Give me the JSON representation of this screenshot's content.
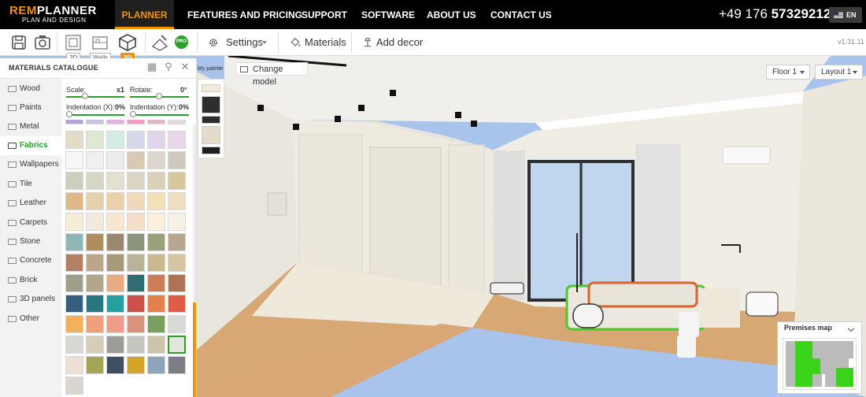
{
  "brand": {
    "name_left": "REM",
    "name_right": "PLANNER",
    "tagline": "PLAN AND DESIGN",
    "accent": "#f29400"
  },
  "nav": {
    "items": [
      "PLANNER",
      "FEATURES AND PRICING",
      "SUPPORT",
      "SOFTWARE",
      "ABOUT US",
      "CONTACT US"
    ],
    "active": "PLANNER",
    "phone_prefix": "+49 176",
    "phone_number": "57329212",
    "language": "EN"
  },
  "toolbar": {
    "icons": [
      "save-icon",
      "screenshot-icon",
      "view-2d-icon",
      "view-walls-icon",
      "view-3d-icon",
      "floor-edit-icon"
    ],
    "view_modes": [
      "2D",
      "Walls",
      "3D"
    ],
    "active_view": "3D",
    "pro_badge": "PRO",
    "settings_label": "Settings",
    "materials_label": "Materials",
    "decor_label": "Add decor",
    "version": "v1.31.11"
  },
  "catalogue": {
    "title": "MATERIALS CATALOGUE",
    "categories": [
      "Wood",
      "Paints",
      "Metal",
      "Fabrics",
      "Wallpapers",
      "Tile",
      "Leather",
      "Carpets",
      "Stone",
      "Concrete",
      "Brick",
      "3D panels",
      "Other"
    ],
    "active_category": "Fabrics",
    "params": {
      "scale_label": "Scale:",
      "scale_value": "x1",
      "rotate_label": "Rotate:",
      "rotate_value": "0°",
      "indent_x_label": "Indentation (X):",
      "indent_x_value": "0%",
      "indent_y_label": "Indentation (Y):",
      "indent_y_value": "0%"
    },
    "swatch_colors": [
      [
        "#e2dcc6",
        "#dfe9d2",
        "#d5ebe6",
        "#d5d9ea",
        "#e0d5ea",
        "#e9d6e8"
      ],
      [
        "#f7f7f7",
        "#f0f0f0",
        "#ececec",
        "#d9c8b3",
        "#dcd6cc",
        "#d1c8bd"
      ],
      [
        "#cccfbc",
        "#d7d7c8",
        "#e3e0cf",
        "#d9d6c5",
        "#dbd1bb",
        "#d6c79f"
      ],
      [
        "#deb987",
        "#e3d2ac",
        "#ebd1a9",
        "#f0d9b8",
        "#f4dfb6",
        "#efddc2"
      ],
      [
        "#f5edd6",
        "#f2eadc",
        "#f7e7d0",
        "#f5dec8",
        "#faf0dc",
        "#f6f1e4"
      ],
      [
        "#8fb6b4",
        "#b08d5e",
        "#9b8770",
        "#88957a",
        "#9b9f7a",
        "#b8a690"
      ],
      [
        "#b28064",
        "#bea58a",
        "#a79a79",
        "#b9b498",
        "#c9b98d",
        "#d4c4a0"
      ],
      [
        "#9d9f8b",
        "#b4a68a",
        "#eaaa84",
        "#2f6d73",
        "#cc7d57",
        "#b07254"
      ],
      [
        "#355f7d",
        "#28767f",
        "#24a09f",
        "#cc5148",
        "#e47f4e",
        "#df5d43"
      ],
      [
        "#f5b05d",
        "#f0a17c",
        "#ef9c8b",
        "#d9937c",
        "#79a05f",
        "#d9d9d6"
      ],
      [
        "#d7d7d3",
        "#d6ccb7",
        "#9c9d98",
        "#c4c7c0",
        "#ccc3ad",
        "#e5e5e0"
      ],
      [
        "#ece0d2",
        "#a4a556",
        "#3f4f62",
        "#d6a22a",
        "#8fa4b8",
        "#7b7f83"
      ],
      [
        "#d9d5cf"
      ]
    ],
    "selected_swatch": "row-11-col-6",
    "top_partial_row": [
      "#b7a3da",
      "#c9c1e6",
      "#e1b3e3",
      "#e9a0c7",
      "#e0b9c7",
      "#e6d9df"
    ]
  },
  "palette": {
    "label": "My palette",
    "colors": [
      "#f3ead9",
      "#2e2e2e",
      "#2c2c2c",
      "#e3dcc9",
      "#1f1f21"
    ]
  },
  "viewport": {
    "change_model_label": "Change model",
    "floor_select": "Floor 1",
    "layout_select": "Layout 1",
    "premises_title": "Premises map"
  }
}
